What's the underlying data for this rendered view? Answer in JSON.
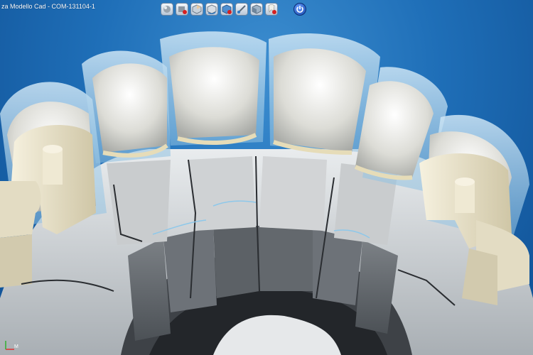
{
  "window": {
    "title": "za Modello Cad  -  COM-131104-1"
  },
  "toolbar": {
    "buttons": [
      {
        "icon": "model-view-icon"
      },
      {
        "icon": "model-remove-icon"
      },
      {
        "icon": "cube-view-icon"
      },
      {
        "icon": "cube-rotate-icon"
      },
      {
        "icon": "cube-delete-icon"
      },
      {
        "icon": "measure-tool-icon"
      },
      {
        "icon": "model-shading-icon"
      },
      {
        "icon": "tooth-delete-icon"
      }
    ],
    "power_icon": "power-icon"
  },
  "viewport": {
    "content": "3d-dental-model",
    "axis_label": "M"
  },
  "colors": {
    "background": "#1f6fb8",
    "model_gray": "#d4d6d8",
    "wax_translucent": "#a9cde6",
    "die_cream": "#e8e2cc"
  }
}
